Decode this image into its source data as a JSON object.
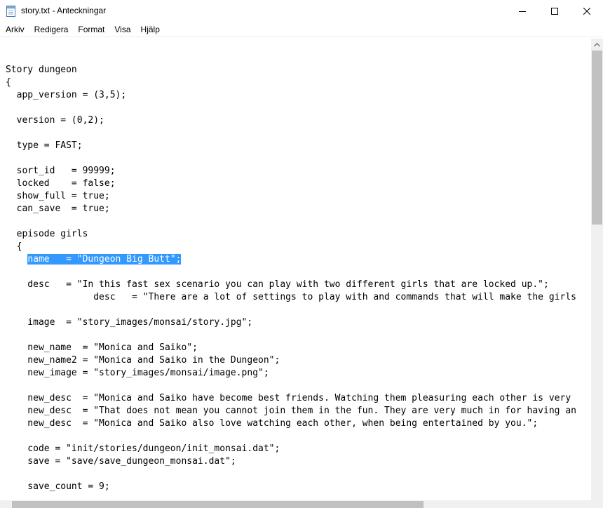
{
  "window": {
    "title": "story.txt - Anteckningar"
  },
  "menu": {
    "items": [
      "Arkiv",
      "Redigera",
      "Format",
      "Visa",
      "Hjälp"
    ]
  },
  "editor": {
    "lines": [
      "Story dungeon",
      "{",
      "  app_version = (3,5);",
      "",
      "  version = (0,2);",
      "",
      "  type = FAST;",
      "",
      "  sort_id   = 99999;",
      "  locked    = false;",
      "  show_full = true;",
      "  can_save  = true;",
      "",
      "  episode girls",
      "  {",
      "",
      "",
      "    desc   = \"In this fast sex scenario you can play with two different girls that are locked up.\";",
      "                desc   = \"There are a lot of settings to play with and commands that will make the girls",
      "",
      "    image  = \"story_images/monsai/story.jpg\";",
      "",
      "    new_name  = \"Monica and Saiko\";",
      "    new_name2 = \"Monica and Saiko in the Dungeon\";",
      "    new_image = \"story_images/monsai/image.png\";",
      "",
      "    new_desc  = \"Monica and Saiko have become best friends. Watching them pleasuring each other is very",
      "    new_desc  = \"That does not mean you cannot join them in the fun. They are very much in for having an",
      "    new_desc  = \"Monica and Saiko also love watching each other, when being entertained by you.\";",
      "",
      "    code = \"init/stories/dungeon/init_monsai.dat\";",
      "    save = \"save/save_dungeon_monsai.dat\";",
      "",
      "    save_count = 9;"
    ],
    "selected_line_prefix": "    ",
    "selected_line_text": "name   = \"Dungeon Big Butt\";"
  },
  "colors": {
    "selection": "#3399ff",
    "scrollbar_track": "#f0f0f0",
    "scrollbar_thumb": "#c1c1c1"
  }
}
